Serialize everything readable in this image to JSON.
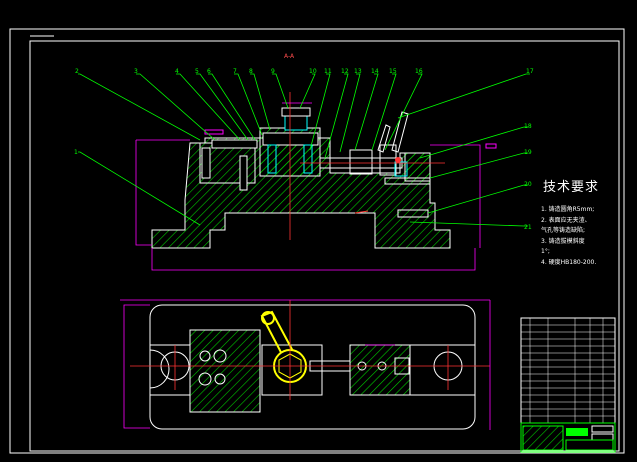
{
  "drawing": {
    "section_label": "A-A",
    "balloon_numbers": [
      "1",
      "2",
      "3",
      "4",
      "5",
      "6",
      "7",
      "8",
      "9",
      "10",
      "11",
      "12",
      "13",
      "14",
      "15",
      "16",
      "17",
      "18",
      "19",
      "20",
      "21"
    ],
    "colors": {
      "background": "#000000",
      "border": "#ffffff",
      "part_outline": "#ffffff",
      "hatch": "#00cc00",
      "leader": "#00ff00",
      "dimension": "#ff00ff",
      "centerline": "#ff3333",
      "component": "#00ffff",
      "handle": "#ffff00",
      "text": "#ffffff"
    }
  },
  "tech_requirements": {
    "title": "技术要求",
    "items": [
      "1. 铸造圆角R5mm;",
      "2. 表面应无夹渣、",
      "   气孔等铸造缺陷;",
      "3. 铸造拔模斜度",
      "   1°;",
      "4. 硬度HB180-200."
    ]
  }
}
